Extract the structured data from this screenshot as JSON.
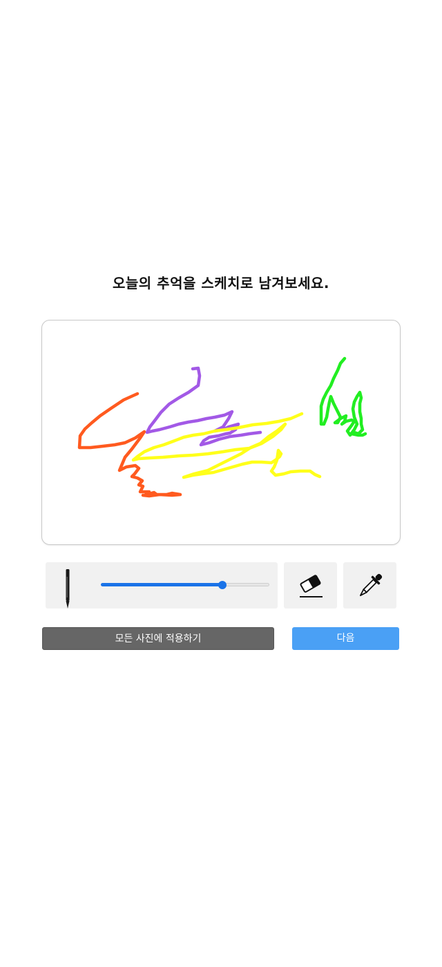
{
  "title": "오늘의 추억을 스케치로 남겨보세요.",
  "canvas": {
    "strokes": [
      {
        "color": "#ff5a1f",
        "name": "orange-stroke"
      },
      {
        "color": "#a259e6",
        "name": "purple-stroke"
      },
      {
        "color": "#ffff1a",
        "name": "yellow-stroke"
      },
      {
        "color": "#22ee22",
        "name": "green-stroke"
      }
    ]
  },
  "toolbar": {
    "pen_icon": "pen-icon",
    "brush_size_fraction": 0.72,
    "eraser_icon": "eraser-icon",
    "eyedropper_icon": "eyedropper-icon",
    "accent_color": "#1a73e8"
  },
  "buttons": {
    "apply_all_label": "모든 사진에 적용하기",
    "next_label": "다음"
  }
}
